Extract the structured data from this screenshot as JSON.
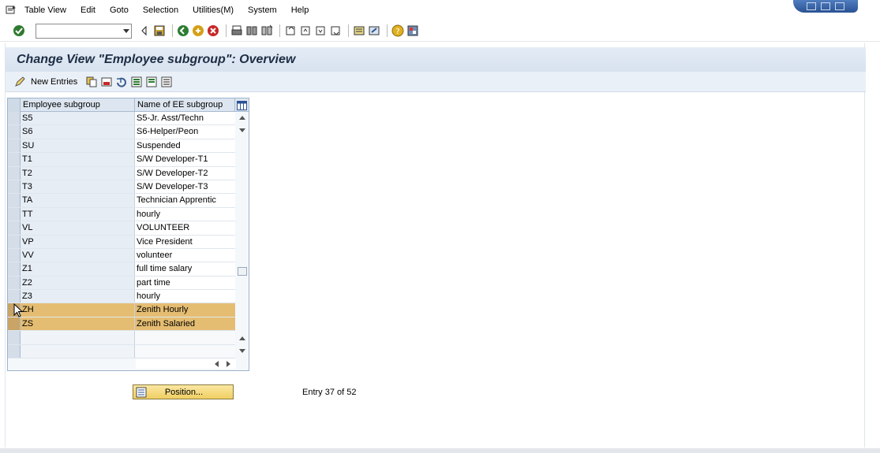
{
  "menubar": {
    "items": [
      {
        "label": "Table View"
      },
      {
        "label": "Edit"
      },
      {
        "label": "Goto"
      },
      {
        "label": "Selection"
      },
      {
        "label": "Utilities(M)"
      },
      {
        "label": "System"
      },
      {
        "label": "Help"
      }
    ]
  },
  "stdbar": {
    "command_value": ""
  },
  "title": "Change View \"Employee subgroup\": Overview",
  "appbar": {
    "new_entries_label": "New Entries"
  },
  "table": {
    "columns": [
      "Employee subgroup",
      "Name of EE subgroup"
    ],
    "rows": [
      {
        "code": "S5",
        "name": "S5-Jr. Asst/Techn"
      },
      {
        "code": "S6",
        "name": "S6-Helper/Peon"
      },
      {
        "code": "SU",
        "name": "Suspended"
      },
      {
        "code": "T1",
        "name": "S/W Developer-T1"
      },
      {
        "code": "T2",
        "name": "S/W Developer-T2"
      },
      {
        "code": "T3",
        "name": "S/W Developer-T3"
      },
      {
        "code": "TA",
        "name": "Technician Apprentic"
      },
      {
        "code": "TT",
        "name": "hourly"
      },
      {
        "code": "VL",
        "name": "VOLUNTEER"
      },
      {
        "code": "VP",
        "name": "Vice President"
      },
      {
        "code": "VV",
        "name": "volunteer"
      },
      {
        "code": "Z1",
        "name": "full time salary"
      },
      {
        "code": "Z2",
        "name": "part time"
      },
      {
        "code": "Z3",
        "name": "hourly"
      },
      {
        "code": "ZH",
        "name": "Zenith Hourly"
      },
      {
        "code": "ZS",
        "name": "Zenith Salaried"
      }
    ],
    "highlight_color": "#e5bd72"
  },
  "position_button_label": "Position...",
  "entry_info": "Entry 37 of 52"
}
